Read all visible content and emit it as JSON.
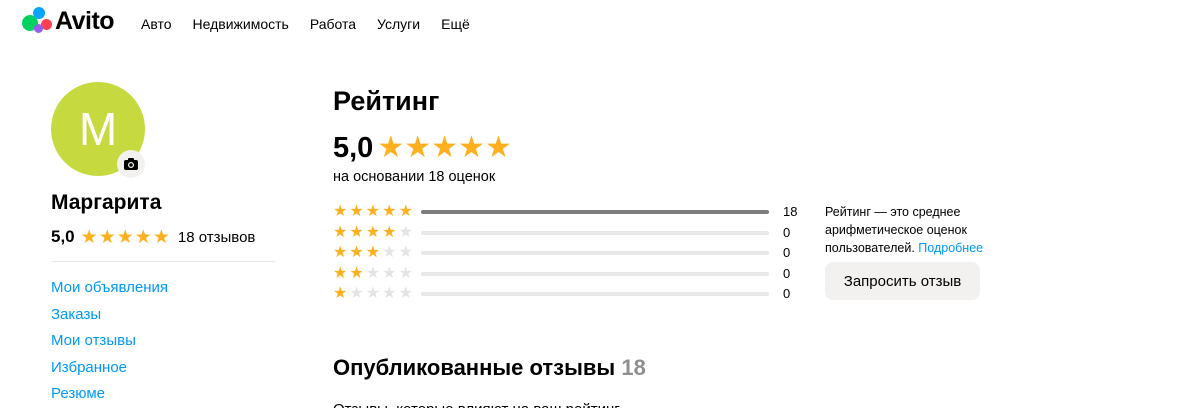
{
  "header": {
    "logo_text": "Avito",
    "nav": [
      "Авто",
      "Недвижимость",
      "Работа",
      "Услуги",
      "Ещё"
    ]
  },
  "profile": {
    "avatar_letter": "M",
    "name": "Маргарита",
    "score": "5,0",
    "stars": 5,
    "reviews_label": "18 отзывов",
    "menu": [
      "Мои объявления",
      "Заказы",
      "Мои отзывы",
      "Избранное",
      "Резюме"
    ]
  },
  "rating": {
    "title": "Рейтинг",
    "score": "5,0",
    "stars": 5,
    "basis": "на основании 18 оценок",
    "breakdown": [
      {
        "stars": 5,
        "count": "18",
        "fraction": 1.0
      },
      {
        "stars": 4,
        "count": "0",
        "fraction": 0
      },
      {
        "stars": 3,
        "count": "0",
        "fraction": 0
      },
      {
        "stars": 2,
        "count": "0",
        "fraction": 0
      },
      {
        "stars": 1,
        "count": "0",
        "fraction": 0
      }
    ],
    "info_text": "Рейтинг — это среднее арифметическое оценок пользователей.",
    "info_link": "Подробнее",
    "request_button": "Запросить отзыв"
  },
  "published": {
    "title": "Опубликованные отзывы",
    "count": "18",
    "subtitle": "Отзывы, которые влияют на ваш рейтинг"
  },
  "colors": {
    "star": "#ffb021",
    "link": "#0099f7",
    "avatar": "#c6d93f",
    "bar_fill": "#7d7d7d"
  }
}
